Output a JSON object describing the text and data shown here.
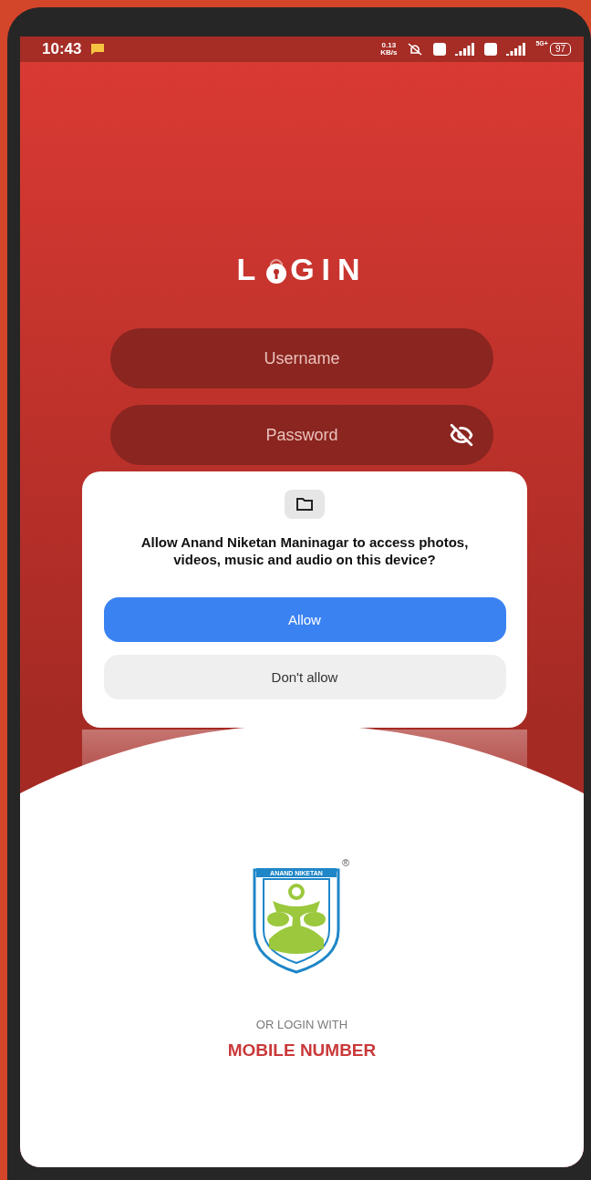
{
  "status_bar": {
    "time": "10:43",
    "speed_value": "0.13",
    "speed_unit": "KB/s",
    "network": "5G+",
    "battery": "97"
  },
  "login": {
    "title_start": "L",
    "title_end": "GIN",
    "username": {
      "placeholder": "Username"
    },
    "password": {
      "placeholder": "Password",
      "hidden": true
    }
  },
  "dialog": {
    "message": "Allow Anand Niketan Maninagar to access photos, videos, music and audio on this device?",
    "buttons": [
      {
        "label": "Allow",
        "kind": "primary"
      },
      {
        "label": "Don't allow",
        "kind": "secondary"
      }
    ]
  },
  "logo": {
    "banner": "ANAND NIKETAN",
    "mark": "®"
  },
  "alt_login": {
    "prompt": "OR LOGIN WITH",
    "link": "MOBILE NUMBER"
  }
}
